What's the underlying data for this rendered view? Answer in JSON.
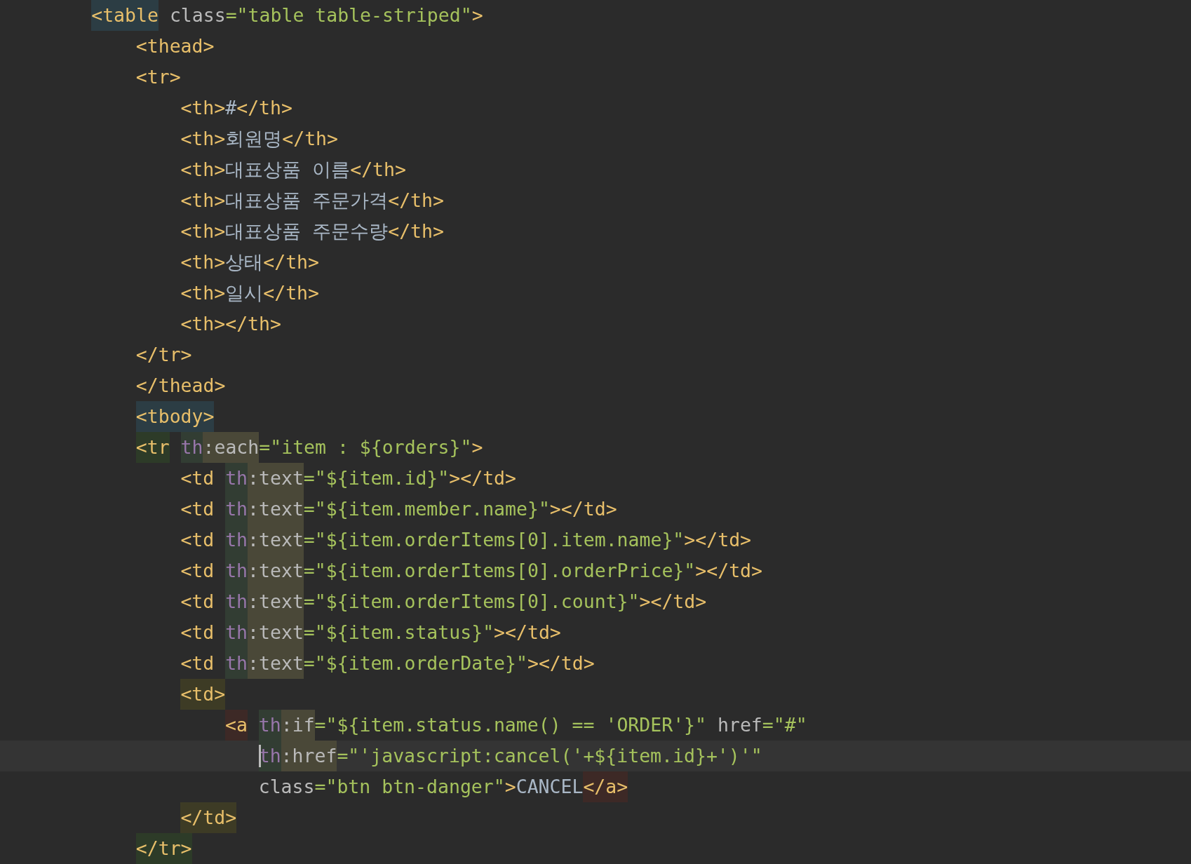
{
  "editor": {
    "lines": [
      {
        "current": false,
        "wrapped": false,
        "tokens": [
          {
            "text": "<table",
            "kind": "tablepair"
          },
          {
            "text": " class",
            "kind": "attr"
          },
          {
            "text": "=\"table table-striped\"",
            "kind": "str"
          },
          {
            "text": ">",
            "kind": "tag"
          }
        ],
        "children": [
          {
            "current": false,
            "tokens": [
              {
                "text": "<thead>",
                "kind": "tag"
              }
            ]
          },
          {
            "current": false,
            "wrapped": false,
            "tokens": [
              {
                "text": "<tr>",
                "kind": "tag"
              }
            ],
            "children": [
              {
                "current": false,
                "tokens": [
                  {
                    "text": "<th>",
                    "kind": "tag"
                  },
                  {
                    "text": "#",
                    "kind": "text"
                  },
                  {
                    "text": "</th>",
                    "kind": "tag"
                  }
                ]
              },
              {
                "current": false,
                "tokens": [
                  {
                    "text": "<th>",
                    "kind": "tag"
                  },
                  {
                    "text": "회원명",
                    "kind": "text"
                  },
                  {
                    "text": "</th>",
                    "kind": "tag"
                  }
                ]
              },
              {
                "current": false,
                "tokens": [
                  {
                    "text": "<th>",
                    "kind": "tag"
                  },
                  {
                    "text": "대표상품 이름",
                    "kind": "text"
                  },
                  {
                    "text": "</th>",
                    "kind": "tag"
                  }
                ]
              },
              {
                "current": false,
                "tokens": [
                  {
                    "text": "<th>",
                    "kind": "tag"
                  },
                  {
                    "text": "대표상품 주문가격",
                    "kind": "text"
                  },
                  {
                    "text": "</th>",
                    "kind": "tag"
                  }
                ]
              },
              {
                "current": false,
                "tokens": [
                  {
                    "text": "<th>",
                    "kind": "tag"
                  },
                  {
                    "text": "대표상품 주문수량",
                    "kind": "text"
                  },
                  {
                    "text": "</th>",
                    "kind": "tag"
                  }
                ]
              },
              {
                "current": false,
                "tokens": [
                  {
                    "text": "<th>",
                    "kind": "tag"
                  },
                  {
                    "text": "상태",
                    "kind": "text"
                  },
                  {
                    "text": "</th>",
                    "kind": "tag"
                  }
                ]
              },
              {
                "current": false,
                "tokens": [
                  {
                    "text": "<th>",
                    "kind": "tag"
                  },
                  {
                    "text": "일시",
                    "kind": "text"
                  },
                  {
                    "text": "</th>",
                    "kind": "tag"
                  }
                ]
              },
              {
                "current": false,
                "tokens": [
                  {
                    "text": "<th></th>",
                    "kind": "tag"
                  }
                ]
              }
            ]
          },
          {
            "current": false,
            "tokens": [
              {
                "text": "</tr>",
                "kind": "tag"
              }
            ]
          },
          {
            "current": false,
            "tokens": [
              {
                "text": "</thead>",
                "kind": "tag"
              }
            ]
          },
          {
            "current": false,
            "tokens": [
              {
                "text": "<tbody>",
                "kind": "tablepair"
              }
            ]
          },
          {
            "current": false,
            "wrapped": false,
            "tokens": [
              {
                "text": "<tr",
                "kind": "rowpair"
              },
              {
                "text": "th",
                "kind": "ns"
              },
              {
                "text": ":each",
                "kind": "nsattr"
              },
              {
                "text": "=\"item : ${orders}\"",
                "kind": "str"
              },
              {
                "text": ">",
                "kind": "tag"
              }
            ],
            "children": [
              {
                "current": false,
                "tokens": [
                  {
                    "text": "<td",
                    "kind": "tag"
                  },
                  {
                    "text": "th",
                    "kind": "ns"
                  },
                  {
                    "text": ":text",
                    "kind": "nsattr"
                  },
                  {
                    "text": "=\"${item.id}\"",
                    "kind": "str"
                  },
                  {
                    "text": "></td>",
                    "kind": "tag"
                  }
                ]
              },
              {
                "current": false,
                "tokens": [
                  {
                    "text": "<td",
                    "kind": "tag"
                  },
                  {
                    "text": "th",
                    "kind": "ns"
                  },
                  {
                    "text": ":text",
                    "kind": "nsattr"
                  },
                  {
                    "text": "=\"${item.member.name}\"",
                    "kind": "str"
                  },
                  {
                    "text": "></td>",
                    "kind": "tag"
                  }
                ]
              },
              {
                "current": false,
                "tokens": [
                  {
                    "text": "<td",
                    "kind": "tag"
                  },
                  {
                    "text": "th",
                    "kind": "ns"
                  },
                  {
                    "text": ":text",
                    "kind": "nsattr"
                  },
                  {
                    "text": "=\"${item.orderItems[0].item.name}\"",
                    "kind": "str"
                  },
                  {
                    "text": "></td>",
                    "kind": "tag"
                  }
                ]
              },
              {
                "current": false,
                "tokens": [
                  {
                    "text": "<td",
                    "kind": "tag"
                  },
                  {
                    "text": "th",
                    "kind": "ns"
                  },
                  {
                    "text": ":text",
                    "kind": "nsattr"
                  },
                  {
                    "text": "=\"${item.orderItems[0].orderPrice}\"",
                    "kind": "str"
                  },
                  {
                    "text": "></td>",
                    "kind": "tag"
                  }
                ]
              },
              {
                "current": false,
                "tokens": [
                  {
                    "text": "<td",
                    "kind": "tag"
                  },
                  {
                    "text": "th",
                    "kind": "ns"
                  },
                  {
                    "text": ":text",
                    "kind": "nsattr"
                  },
                  {
                    "text": "=\"${item.orderItems[0].count}\"",
                    "kind": "str"
                  },
                  {
                    "text": "></td>",
                    "kind": "tag"
                  }
                ]
              },
              {
                "current": false,
                "tokens": [
                  {
                    "text": "<td",
                    "kind": "tag"
                  },
                  {
                    "text": "th",
                    "kind": "ns"
                  },
                  {
                    "text": ":text",
                    "kind": "nsattr"
                  },
                  {
                    "text": "=\"${item.status}\"",
                    "kind": "str"
                  },
                  {
                    "text": "></td>",
                    "kind": "tag"
                  }
                ]
              },
              {
                "current": false,
                "tokens": [
                  {
                    "text": "<td",
                    "kind": "tag"
                  },
                  {
                    "text": "th",
                    "kind": "ns"
                  },
                  {
                    "text": ":text",
                    "kind": "nsattr"
                  },
                  {
                    "text": "=\"${item.orderDate}\"",
                    "kind": "str"
                  },
                  {
                    "text": "></td>",
                    "kind": "tag"
                  }
                ]
              },
              {
                "current": false,
                "wrapped": false,
                "tokens": [
                  {
                    "text": "<td>",
                    "kind": "cellpair"
                  }
                ],
                "children": [
                  {
                    "current": false,
                    "wrapped": true,
                    "tokens": [
                      {
                        "text": "<a",
                        "kind": "linkpair"
                      },
                      {
                        "text": "th",
                        "kind": "ns"
                      },
                      {
                        "text": ":if",
                        "kind": "nsattr"
                      },
                      {
                        "text": "=\"${item.status.name() == 'ORDER'}\"",
                        "kind": "str"
                      },
                      {
                        "text": " href",
                        "kind": "attr"
                      },
                      {
                        "text": "=\"#\"",
                        "kind": "str"
                      }
                    ],
                    "children": [
                      {
                        "current": true,
                        "tokens": [
                          {
                            "text": "th",
                            "kind": "ns"
                          },
                          {
                            "text": ":href",
                            "kind": "nsattr"
                          },
                          {
                            "text": "=\"'javascript:cancel('+${item.id}+')'\"",
                            "kind": "str"
                          }
                        ]
                      },
                      {
                        "current": false,
                        "tokens": [
                          {
                            "text": "class",
                            "kind": "attr"
                          },
                          {
                            "text": "=\"btn btn-danger\"",
                            "kind": "str"
                          },
                          {
                            "text": ">",
                            "kind": "tag"
                          },
                          {
                            "text": "CANCEL",
                            "kind": "text"
                          },
                          {
                            "text": "</a>",
                            "kind": "linkpair"
                          }
                        ]
                      }
                    ]
                  }
                ]
              },
              {
                "current": false,
                "tokens": [
                  {
                    "text": "</td>",
                    "kind": "cellpair"
                  }
                ]
              }
            ]
          },
          {
            "current": false,
            "tokens": [
              {
                "text": "</tr>",
                "kind": "rowpair"
              }
            ]
          }
        ]
      }
    ]
  }
}
